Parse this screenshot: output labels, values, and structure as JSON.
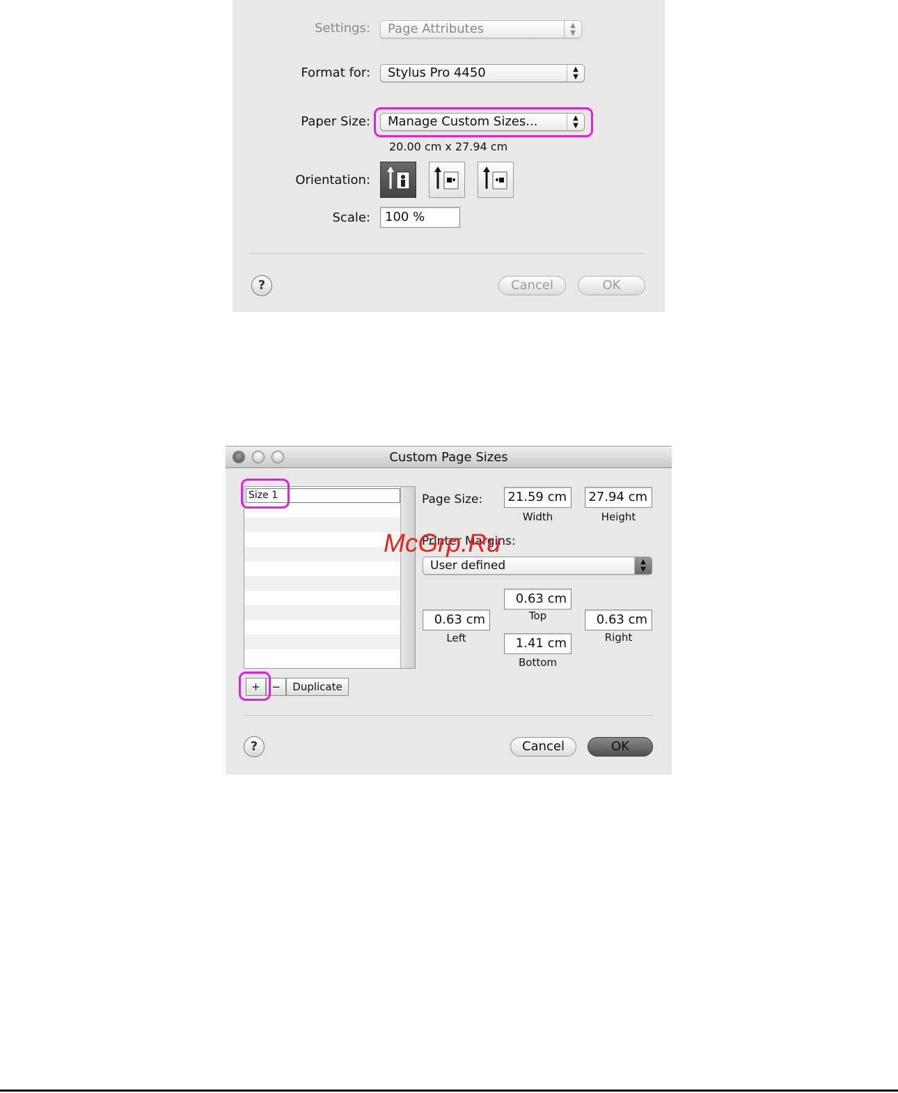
{
  "page_setup": {
    "settings_label": "Settings:",
    "settings_value": "Page Attributes",
    "format_label": "Format for:",
    "format_value": "Stylus Pro 4450",
    "paper_size_label": "Paper Size:",
    "paper_size_value": "Manage Custom Sizes...",
    "paper_dimensions": "20.00 cm x 27.94 cm",
    "orientation_label": "Orientation:",
    "orientation_options": [
      "portrait",
      "landscape-left",
      "landscape-right"
    ],
    "orientation_selected": "portrait",
    "scale_label": "Scale:",
    "scale_value": "100 %",
    "help_label": "?",
    "cancel_label": "Cancel",
    "ok_label": "OK"
  },
  "custom_sizes": {
    "title": "Custom Page Sizes",
    "sizes": [
      "Size 1"
    ],
    "add_label": "+",
    "remove_label": "−",
    "duplicate_label": "Duplicate",
    "page_size_label": "Page Size:",
    "width_value": "21.59 cm",
    "width_caption": "Width",
    "height_value": "27.94 cm",
    "height_caption": "Height",
    "margins_label": "Printer Margins:",
    "margins_value": "User defined",
    "top_value": "0.63 cm",
    "top_caption": "Top",
    "left_value": "0.63 cm",
    "left_caption": "Left",
    "right_value": "0.63 cm",
    "right_caption": "Right",
    "bottom_value": "1.41 cm",
    "bottom_caption": "Bottom",
    "help_label": "?",
    "cancel_label": "Cancel",
    "ok_label": "OK"
  },
  "watermark": "McGrp.Ru",
  "colors": {
    "highlight": "#e020e0",
    "watermark": "#e8241c",
    "dialog_bg": "#e8e8e8"
  }
}
